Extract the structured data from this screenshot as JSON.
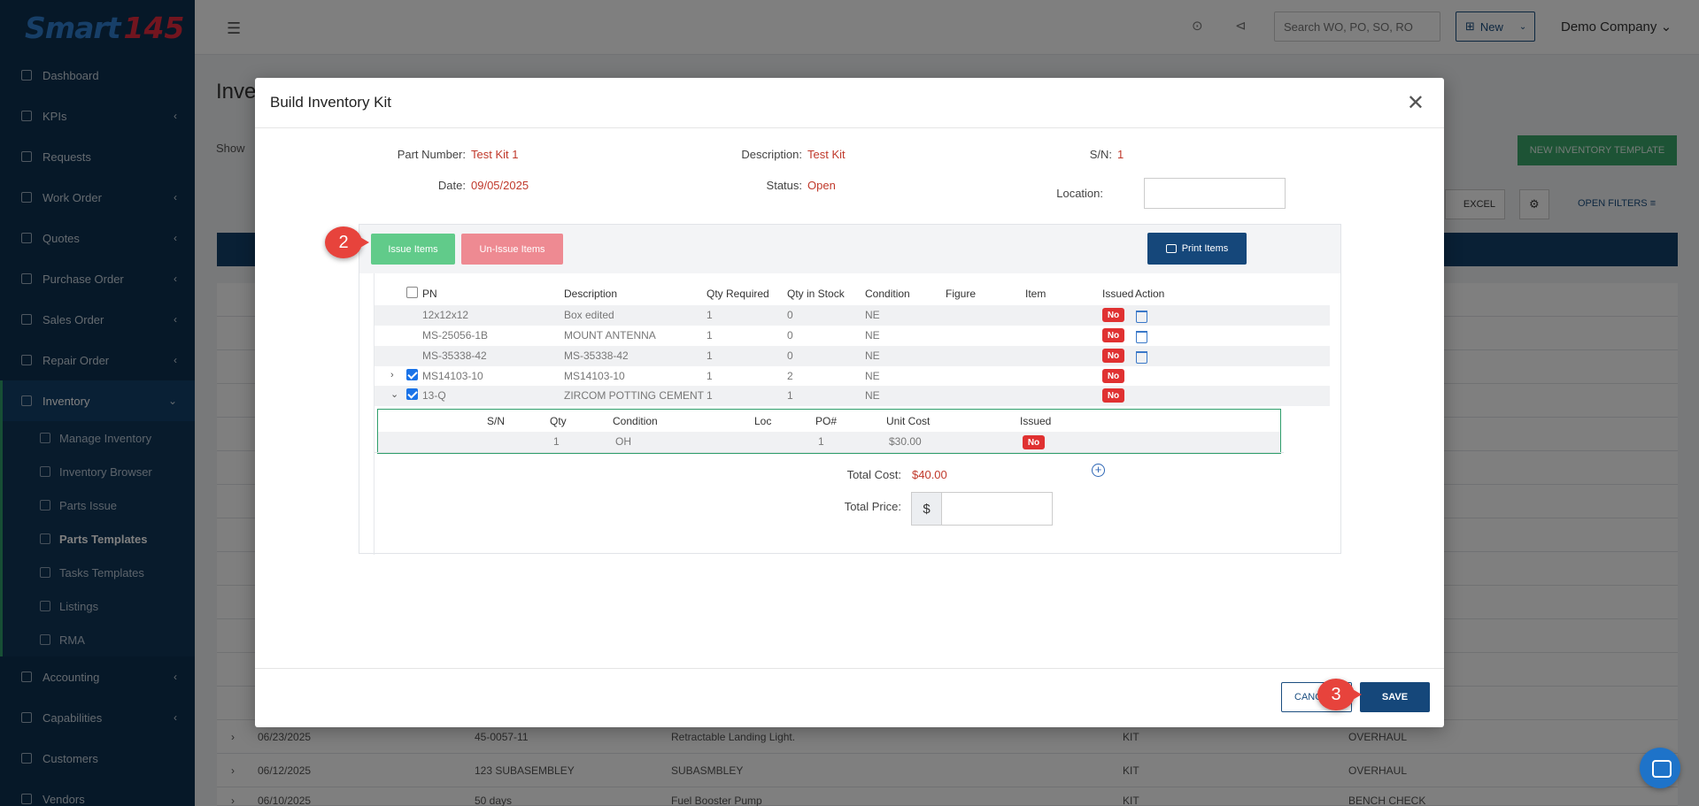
{
  "logo": {
    "part1": "Smart",
    "part2": "145"
  },
  "nav": {
    "items": [
      {
        "label": "Dashboard",
        "icon": "chart-icon",
        "chevron": false
      },
      {
        "label": "KPIs",
        "icon": "chart-icon",
        "chevron": true
      },
      {
        "label": "Requests",
        "icon": "document-icon",
        "chevron": false
      },
      {
        "label": "Work Order",
        "icon": "clipboard-icon",
        "chevron": true
      },
      {
        "label": "Quotes",
        "icon": "document-icon",
        "chevron": true
      },
      {
        "label": "Purchase Order",
        "icon": "cart-icon",
        "chevron": true
      },
      {
        "label": "Sales Order",
        "icon": "list-icon",
        "chevron": true
      },
      {
        "label": "Repair Order",
        "icon": "wrench-icon",
        "chevron": true
      },
      {
        "label": "Inventory",
        "icon": "inventory-icon",
        "chevron": true,
        "active": true
      }
    ],
    "sub_items": [
      {
        "label": "Manage Inventory",
        "icon": "manage-icon"
      },
      {
        "label": "Inventory Browser",
        "icon": "globe-icon"
      },
      {
        "label": "Parts Issue",
        "icon": "branch-icon"
      },
      {
        "label": "Parts Templates",
        "icon": "branch-icon",
        "active": true
      },
      {
        "label": "Tasks Templates",
        "icon": "branch-icon"
      },
      {
        "label": "Listings",
        "icon": "list-icon"
      },
      {
        "label": "RMA",
        "icon": "truck-icon"
      }
    ],
    "bottom_items": [
      {
        "label": "Accounting",
        "icon": "accounting-icon",
        "chevron": true
      },
      {
        "label": "Capabilities",
        "icon": "capabilities-icon",
        "chevron": true
      },
      {
        "label": "Customers",
        "icon": "users-icon",
        "chevron": false
      },
      {
        "label": "Vendors",
        "icon": "vendor-icon",
        "chevron": false
      }
    ]
  },
  "topbar": {
    "search_placeholder": "Search WO, PO, SO, RO",
    "new_label": "New",
    "company": "Demo Company"
  },
  "background": {
    "page_title": "Inve",
    "show_label": "Show",
    "new_template_label": "NEW INVENTORY TEMPLATE",
    "excel_label": "EXCEL",
    "open_filters_label": "OPEN FILTERS",
    "rows": [
      {
        "date": "06/23/2025",
        "pn": "45-0057-11",
        "desc": "Retractable Landing Light.",
        "type": "KIT",
        "work": "OVERHAUL"
      },
      {
        "date": "06/12/2025",
        "pn": "123 SUBASEMBLEY",
        "desc": "SUBASMBLEY",
        "type": "KIT",
        "work": "OVERHAUL"
      },
      {
        "date": "06/10/2025",
        "pn": "50 days",
        "desc": "Fuel Booster Pump",
        "type": "KIT",
        "work": "BENCH CHECK"
      }
    ]
  },
  "modal": {
    "title": "Build Inventory Kit",
    "fields": {
      "part_number_label": "Part Number:",
      "part_number": "Test Kit 1",
      "description_label": "Description:",
      "description": "Test Kit",
      "sn_label": "S/N:",
      "sn": "1",
      "date_label": "Date:",
      "date": "09/05/2025",
      "status_label": "Status:",
      "status": "Open",
      "location_label": "Location:",
      "location": ""
    },
    "buttons": {
      "issue": "Issue Items",
      "unissue": "Un-Issue Items",
      "print": "Print Items",
      "cancel": "CANCEL",
      "save": "SAVE"
    },
    "table": {
      "headers": [
        "PN",
        "Description",
        "Qty Required",
        "Qty in Stock",
        "Condition",
        "Figure",
        "Item",
        "Issued",
        "Action"
      ],
      "rows": [
        {
          "pn": "12x12x12",
          "desc": "Box edited",
          "qty_req": "1",
          "qty_stock": "0",
          "cond": "NE",
          "issued": "No",
          "checkbox": false,
          "expand": "",
          "trash": true
        },
        {
          "pn": "MS-25056-1B",
          "desc": "MOUNT ANTENNA",
          "qty_req": "1",
          "qty_stock": "0",
          "cond": "NE",
          "issued": "No",
          "checkbox": false,
          "expand": "",
          "trash": true
        },
        {
          "pn": "MS-35338-42",
          "desc": "MS-35338-42",
          "qty_req": "1",
          "qty_stock": "0",
          "cond": "NE",
          "issued": "No",
          "checkbox": false,
          "expand": "",
          "trash": true
        },
        {
          "pn": "MS14103-10",
          "desc": "MS14103-10",
          "qty_req": "1",
          "qty_stock": "2",
          "cond": "NE",
          "issued": "No",
          "checkbox": true,
          "checked": true,
          "expand": "›",
          "trash": false
        },
        {
          "pn": "13-Q",
          "desc": "ZIRCOM POTTING CEMENT",
          "qty_req": "1",
          "qty_stock": "1",
          "cond": "NE",
          "issued": "No",
          "checkbox": true,
          "checked": true,
          "expand": "⌄",
          "trash": false
        }
      ],
      "sub_headers": [
        "S/N",
        "Qty",
        "Condition",
        "Loc",
        "PO#",
        "Unit Cost",
        "Issued"
      ],
      "sub_row": {
        "sn": "",
        "qty": "1",
        "cond": "OH",
        "loc": "",
        "po": "1",
        "unit_cost": "$30.00",
        "issued": "No"
      }
    },
    "totals": {
      "total_cost_label": "Total Cost:",
      "total_cost": "$40.00",
      "total_price_label": "Total Price:",
      "currency": "$",
      "total_price": ""
    }
  },
  "steps": {
    "issue_step": "2",
    "save_step": "3"
  }
}
